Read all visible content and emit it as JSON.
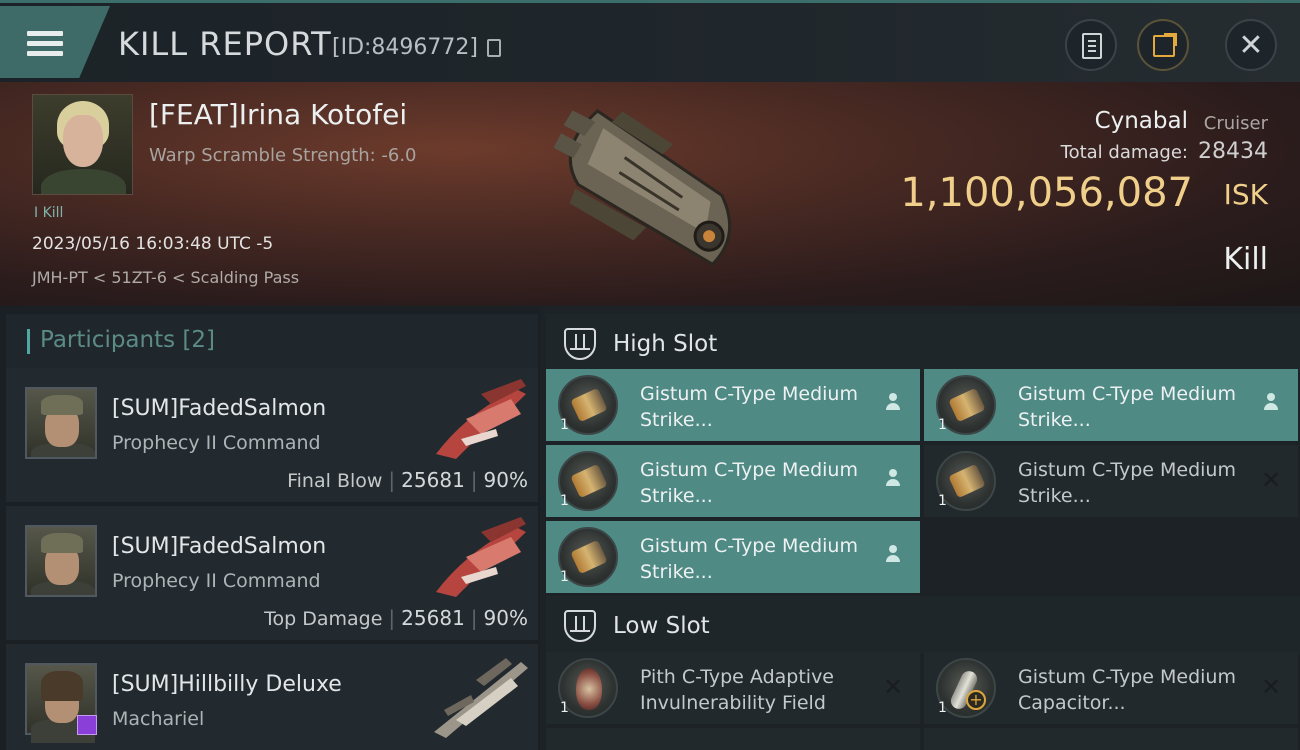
{
  "header": {
    "title": "KILL REPORT",
    "report_id": "[ID:8496772]",
    "icons": {
      "menu": "hamburger-icon",
      "copy": "copy-icon",
      "clipboard": "clipboard-icon",
      "share": "share-icon",
      "close": "close-icon"
    }
  },
  "victim": {
    "name": "[FEAT]Irina Kotofei",
    "scramble": "Warp Scramble Strength: -6.0",
    "tag": "I Kill",
    "time": "2023/05/16 16:03:48 UTC -5",
    "location": "JMH-PT < 51ZT-6 < Scalding Pass",
    "ship_name": "Cynabal",
    "ship_class": "Cruiser",
    "damage_label": "Total damage:",
    "damage_value": "28434",
    "isk_value": "1,100,056,087",
    "isk_unit": "ISK",
    "result": "Kill"
  },
  "participants": {
    "title": "Participants [2]",
    "rows": [
      {
        "name": "[SUM]FadedSalmon",
        "ship": "Prophecy II Command",
        "stat_label": "Final Blow",
        "damage": "25681",
        "percent": "90%"
      },
      {
        "name": "[SUM]FadedSalmon",
        "ship": "Prophecy II Command",
        "stat_label": "Top Damage",
        "damage": "25681",
        "percent": "90%"
      },
      {
        "name": "[SUM]Hillbilly Deluxe",
        "ship": "Machariel"
      }
    ]
  },
  "slots": {
    "high": {
      "title": "High Slot",
      "modules": [
        {
          "name": "Gistum C-Type Medium Strike...",
          "qty": "1",
          "status": "dropped"
        },
        {
          "name": "Gistum C-Type Medium Strike...",
          "qty": "1",
          "status": "dropped"
        },
        {
          "name": "Gistum C-Type Medium Strike...",
          "qty": "1",
          "status": "dropped"
        },
        {
          "name": "Gistum C-Type Medium Strike...",
          "qty": "1",
          "status": "destroyed"
        },
        {
          "name": "Gistum C-Type Medium Strike...",
          "qty": "1",
          "status": "dropped"
        }
      ]
    },
    "low": {
      "title": "Low Slot",
      "modules": [
        {
          "name": "Pith C-Type Adaptive Invulnerability Field",
          "qty": "1",
          "status": "destroyed"
        },
        {
          "name": "Gistum C-Type Medium Capacitor...",
          "qty": "1",
          "status": "destroyed"
        }
      ]
    },
    "status_glyphs": {
      "destroyed": "✕"
    }
  },
  "colors": {
    "accent": "#4f8a84",
    "isk": "#f0cf8a",
    "header_accent": "#3e6a68"
  }
}
